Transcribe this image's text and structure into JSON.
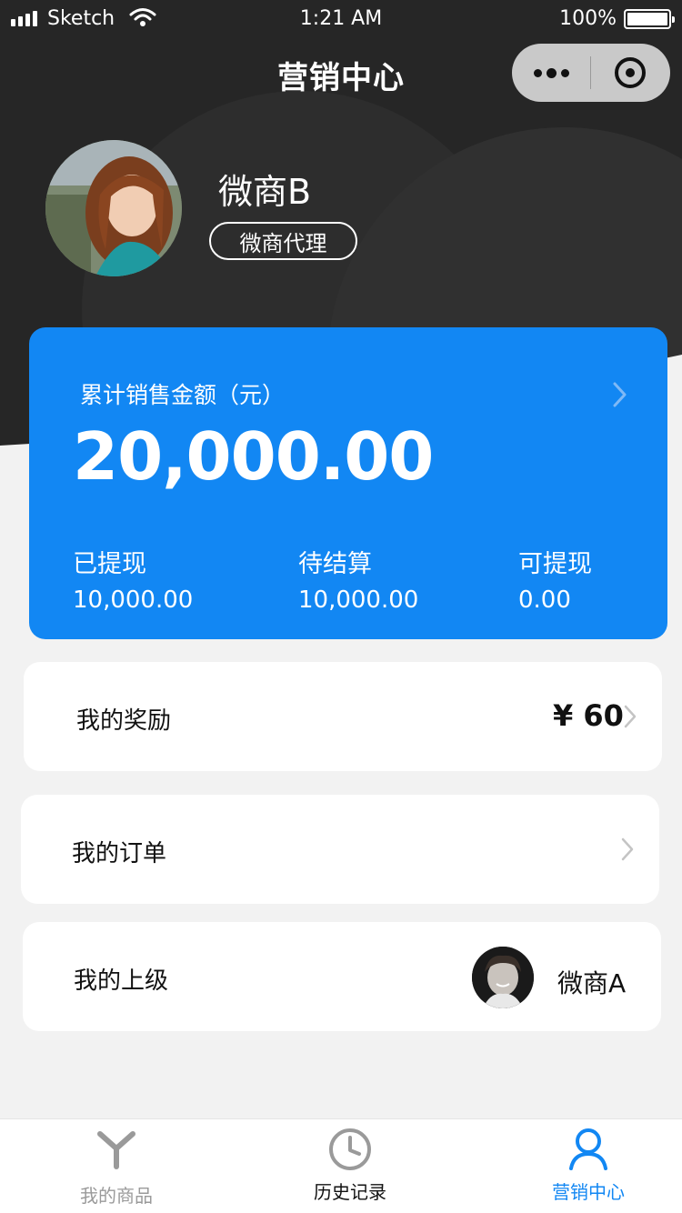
{
  "status_bar": {
    "carrier": "Sketch",
    "time": "1:21 AM",
    "battery": "100%"
  },
  "nav": {
    "title": "营销中心"
  },
  "profile": {
    "name": "微商B",
    "role": "微商代理"
  },
  "sales": {
    "label": "累计销售金额（元）",
    "amount": "20,000.00",
    "stats": [
      {
        "label": "已提现",
        "value": "10,000.00"
      },
      {
        "label": "待结算",
        "value": "10,000.00"
      },
      {
        "label": "可提现",
        "value": "0.00"
      }
    ]
  },
  "reward": {
    "label": "我的奖励",
    "value": "¥ 60"
  },
  "orders": {
    "label": "我的订单"
  },
  "superior": {
    "label": "我的上级",
    "name": "微商A"
  },
  "tabs": [
    {
      "label": "我的商品",
      "icon": "product-icon",
      "color": "#9a9a9a"
    },
    {
      "label": "历史记录",
      "icon": "clock-icon",
      "color": "#111111"
    },
    {
      "label": "营销中心",
      "icon": "person-icon",
      "color": "#1287f3"
    }
  ],
  "colors": {
    "accent": "#1287f3",
    "header": "#262626"
  }
}
